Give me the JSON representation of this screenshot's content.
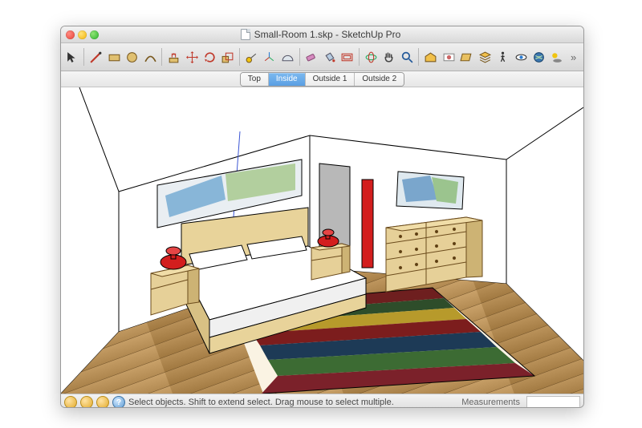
{
  "window": {
    "filename": "Small-Room 1.skp",
    "app": "SketchUp Pro",
    "title": "Small-Room 1.skp - SketchUp Pro"
  },
  "toolbar": {
    "items": [
      "select",
      "line",
      "rectangle",
      "circle",
      "arc",
      "push-pull",
      "move",
      "rotate",
      "scale",
      "tape",
      "axes",
      "protractor",
      "eraser",
      "paint",
      "offset",
      "orbit",
      "pan",
      "zoom",
      "warehouse",
      "match-photo",
      "section",
      "layers",
      "walkthrough",
      "look-around",
      "geo",
      "shadows"
    ]
  },
  "scenes": {
    "tabs": [
      "Top",
      "Inside",
      "Outside 1",
      "Outside 2"
    ],
    "active_index": 1
  },
  "status": {
    "hint": "Select objects. Shift to extend select. Drag mouse to select multiple.",
    "measurements_label": "Measurements",
    "measurements_value": ""
  }
}
